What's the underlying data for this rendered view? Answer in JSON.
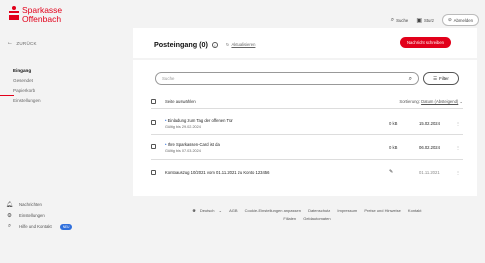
{
  "brand": {
    "line1": "Sparkasse",
    "line2": "Offenbach",
    "color": "#e2001a"
  },
  "sidebar": {
    "back_label": "ZURÜCK",
    "items": [
      {
        "label": "Eingang",
        "active": true
      },
      {
        "label": "Gesendet"
      },
      {
        "label": "Papierkorb"
      },
      {
        "label": "Einstellungen"
      }
    ],
    "bottom": [
      {
        "label": "Nachrichten",
        "icon": "bell-icon"
      },
      {
        "label": "Einstellungen",
        "icon": "gear-icon"
      },
      {
        "label": "Hilfe und Kontakt",
        "icon": "help-icon",
        "badge": "NEU"
      }
    ]
  },
  "topbar": {
    "search": "Suche",
    "postbox": "Sturz",
    "logout": "Abmelden"
  },
  "header": {
    "title": "Posteingang (0)",
    "refresh": "Aktualisieren",
    "compose": "Nachricht schreiben"
  },
  "list": {
    "search_placeholder": "Suche",
    "filter": "Filter",
    "select_all": "Seite auswählen",
    "sort_label": "Sortierung:",
    "sort_value": "Datum (Absteigend)",
    "rows": [
      {
        "title": "Einladung zum Tag der offenen Tür",
        "sub": "Gültig bis 29.02.2024",
        "size": "0 kB",
        "date": "15.02.2024",
        "unread": true
      },
      {
        "title": "Ihre Sparkassen-Card ist da",
        "sub": "Gültig bis 07.03.2024",
        "size": "0 kB",
        "date": "06.02.2024",
        "unread": true
      },
      {
        "title": "Kontoauszug 10/2021 vom 01.11.2021 zu Konto 123456",
        "sub": "",
        "size": "",
        "date": "01.11.2021",
        "unread": false
      }
    ]
  },
  "footer": {
    "links": [
      "Deutsch",
      "AGB",
      "Cookie-Einstellungen anpassen",
      "Datenschutz",
      "Impressum",
      "Preise und Hinweise",
      "Kontakt",
      "Filialen",
      "Geldautomaten"
    ]
  }
}
